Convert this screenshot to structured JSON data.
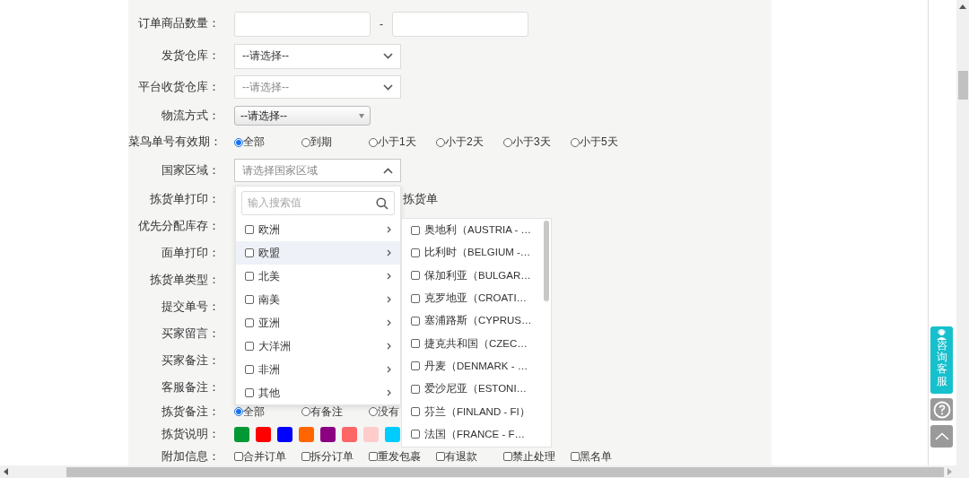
{
  "form": {
    "rows": [
      {
        "kind": "range",
        "label": "订单商品数量：",
        "separator": "-"
      },
      {
        "kind": "select",
        "label": "发货仓库：",
        "value": "--请选择--"
      },
      {
        "kind": "select",
        "label": "平台收货仓库：",
        "placeholder": "--请选择--"
      },
      {
        "kind": "native-select",
        "label": "物流方式：",
        "value": "--请选择--"
      },
      {
        "kind": "radio",
        "label": "菜鸟单号有效期：",
        "options": [
          {
            "label": "全部",
            "selected": true
          },
          {
            "label": "到期",
            "selected": false
          },
          {
            "label": "小于1天",
            "selected": false
          },
          {
            "label": "小于2天",
            "selected": false
          },
          {
            "label": "小于3天",
            "selected": false
          },
          {
            "label": "小于5天",
            "selected": false
          }
        ]
      },
      {
        "kind": "region",
        "label": "国家区域：",
        "placeholder": "请选择国家区域",
        "expanded": true
      },
      {
        "kind": "text",
        "label": "拣货单打印：",
        "text": "拣货单"
      },
      {
        "kind": "plain",
        "label": "优先分配库存："
      },
      {
        "kind": "plain",
        "label": "面单打印："
      },
      {
        "kind": "plain",
        "label": "拣货单类型："
      },
      {
        "kind": "plain",
        "label": "提交单号："
      },
      {
        "kind": "plain",
        "label": "买家留言："
      },
      {
        "kind": "plain",
        "label": "买家备注："
      },
      {
        "kind": "plain",
        "label": "客服备注："
      },
      {
        "kind": "radio",
        "label": "拣货备注：",
        "options": [
          {
            "label": "全部",
            "selected": true
          },
          {
            "label": "有备注",
            "selected": false
          },
          {
            "label": "没有",
            "selected": false
          }
        ]
      },
      {
        "kind": "swatches",
        "label": "拣货说明：",
        "colors": [
          {
            "color": "#009933"
          },
          {
            "color": "#ff0000"
          },
          {
            "color": "#0000ff"
          },
          {
            "color": "#ff6600"
          },
          {
            "color": "#8b0080"
          },
          {
            "color": "#ff6666"
          },
          {
            "color": "#ffcccc"
          },
          {
            "color": "#00ccff"
          }
        ]
      },
      {
        "kind": "checkboxes",
        "label": "附加信息：",
        "options": [
          {
            "label": "合并订单",
            "checked": false
          },
          {
            "label": "拆分订单",
            "checked": false
          },
          {
            "label": "重发包裹",
            "checked": false
          },
          {
            "label": "有退款",
            "checked": false
          },
          {
            "label": "禁止处理",
            "checked": false
          },
          {
            "label": "黑名单",
            "checked": false
          }
        ]
      }
    ]
  },
  "region_dropdown": {
    "search_placeholder": "输入搜索值",
    "groups": [
      {
        "label": "欧洲",
        "checked": false,
        "selected": false
      },
      {
        "label": "欧盟",
        "checked": false,
        "selected": true
      },
      {
        "label": "北美",
        "checked": false,
        "selected": false
      },
      {
        "label": "南美",
        "checked": false,
        "selected": false
      },
      {
        "label": "亚洲",
        "checked": false,
        "selected": false
      },
      {
        "label": "大洋洲",
        "checked": false,
        "selected": false
      },
      {
        "label": "非洲",
        "checked": false,
        "selected": false
      },
      {
        "label": "其他",
        "checked": false,
        "selected": false
      }
    ],
    "countries": [
      {
        "label": "奥地利（AUSTRIA - …",
        "checked": false
      },
      {
        "label": "比利时（BELGIUM -…",
        "checked": false
      },
      {
        "label": "保加利亚（BULGAR…",
        "checked": false
      },
      {
        "label": "克罗地亚（CROATI…",
        "checked": false
      },
      {
        "label": "塞浦路斯（CYPRUS…",
        "checked": false
      },
      {
        "label": "捷克共和国（CZEC…",
        "checked": false
      },
      {
        "label": "丹麦（DENMARK - …",
        "checked": false
      },
      {
        "label": "爱沙尼亚（ESTONI…",
        "checked": false
      },
      {
        "label": "芬兰（FINLAND - FI）",
        "checked": false
      },
      {
        "label": "法国（FRANCE - F…",
        "checked": false
      }
    ]
  },
  "floating": {
    "service_label": "咨询客服"
  }
}
